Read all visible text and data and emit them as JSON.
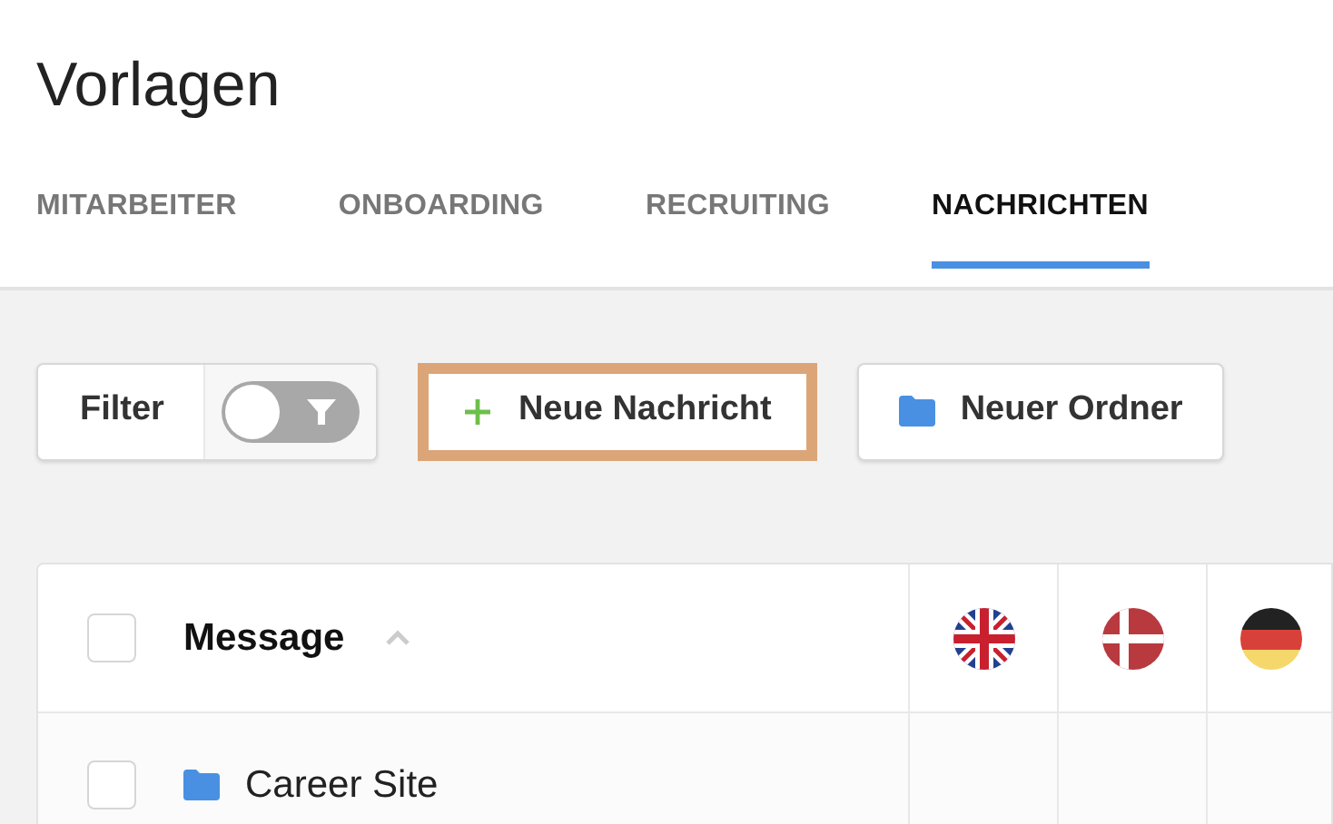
{
  "page": {
    "title": "Vorlagen"
  },
  "tabs": [
    {
      "label": "MITARBEITER",
      "selected": false
    },
    {
      "label": "ONBOARDING",
      "selected": false
    },
    {
      "label": "RECRUITING",
      "selected": false
    },
    {
      "label": "NACHRICHTEN",
      "selected": true
    }
  ],
  "toolbar": {
    "filter": {
      "label": "Filter",
      "on": false
    },
    "buttons": [
      {
        "kind": "add",
        "label": "Neue Nachricht",
        "highlighted": true
      },
      {
        "kind": "folder",
        "label": "Neuer Ordner",
        "highlighted": false
      }
    ]
  },
  "table": {
    "select_all": {
      "checked": false
    },
    "columns": [
      {
        "kind": "text",
        "label": "Message",
        "sorted_ascending": true
      },
      {
        "kind": "uk"
      },
      {
        "kind": "denmark"
      },
      {
        "kind": "germany"
      }
    ],
    "rows": [
      {
        "kind": "folder",
        "label": "Career Site",
        "checked": false
      }
    ]
  }
}
